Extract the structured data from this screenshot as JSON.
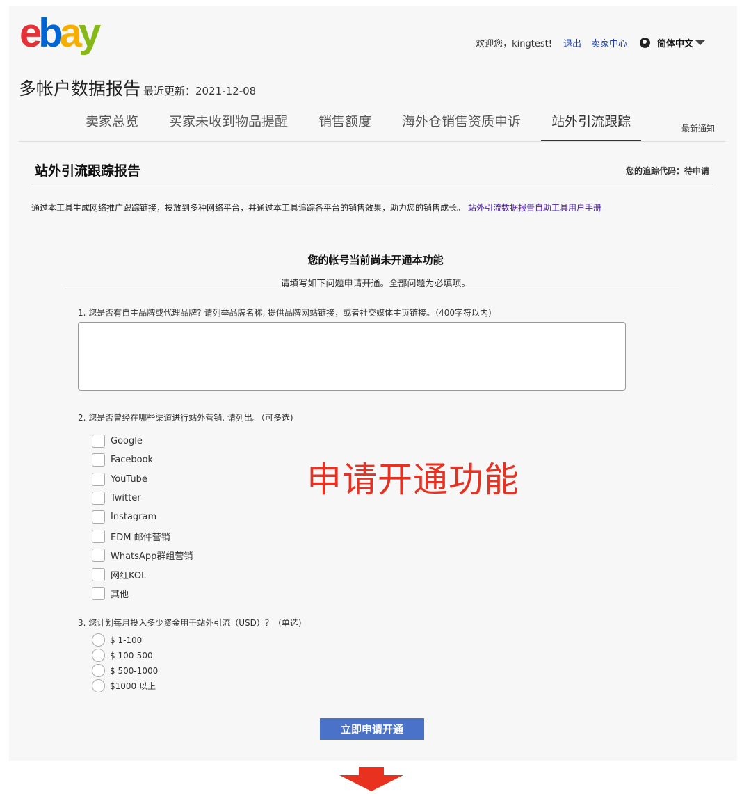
{
  "logo": {
    "e": "e",
    "b": "b",
    "a": "a",
    "y": "y"
  },
  "header": {
    "welcome": "欢迎您，kingtest!",
    "logout": "退出",
    "seller_center": "卖家中心",
    "language": "简体中文"
  },
  "page": {
    "title": "多帐户数据报告",
    "updated": "最近更新：2021-12-08"
  },
  "tabs": [
    {
      "label": "卖家总览"
    },
    {
      "label": "买家未收到物品提醒"
    },
    {
      "label": "销售额度"
    },
    {
      "label": "海外仓销售资质申诉"
    },
    {
      "label": "站外引流跟踪",
      "active": true
    }
  ],
  "news_label": "最新通知",
  "section": {
    "title": "站外引流跟踪报告",
    "tracking_code": "您的追踪代码：待申请",
    "intro": "通过本工具生成网络推广跟踪链接，投放到多种网络平台，并通过本工具追踪各平台的销售效果，助力您的销售成长。",
    "manual_link": "站外引流数据报告自助工具用户手册"
  },
  "notice": {
    "heading": "您的帐号当前尚未开通本功能",
    "sub": "请填写如下问题申请开通。全部问题为必填项。"
  },
  "questions": {
    "q1": "1. 您是否有自主品牌或代理品牌? 请列举品牌名称, 提供品牌网站链接，或者社交媒体主页链接。（400字符以内)",
    "q1_value": "",
    "q2": "2. 您是否曾经在哪些渠道进行站外营销, 请列出。（可多选)",
    "q2_options": [
      "Google",
      "Facebook",
      "YouTube",
      "Twitter",
      "Instagram",
      "EDM 邮件营销",
      "WhatsApp群组营销",
      "网红KOL",
      "其他"
    ],
    "q3": "3. 您计划每月投入多少资金用于站外引流（USD）？（单选)",
    "q3_options": [
      "$ 1-100",
      "$ 100-500",
      "$ 500-1000",
      "$1000 以上"
    ]
  },
  "annotation": "申请开通功能",
  "submit_label": "立即申请开通",
  "colors": {
    "accent": "#4a72c8",
    "annotation": "#e53223",
    "arrow": "#e8321f",
    "link": "#1a3ea5"
  }
}
